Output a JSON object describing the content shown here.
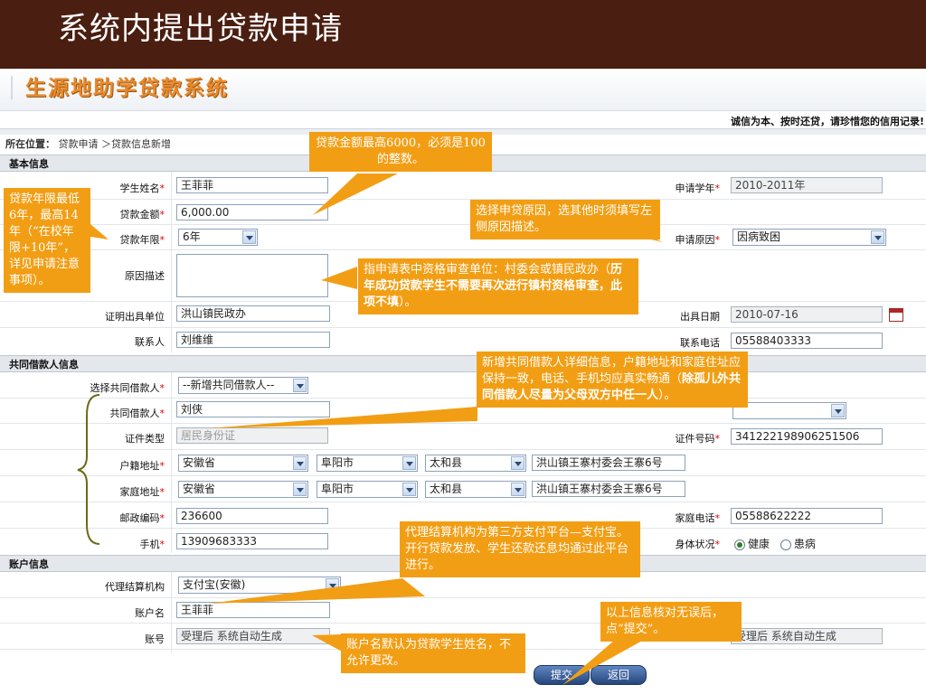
{
  "slide": {
    "title": "系统内提出贷款申请"
  },
  "app": {
    "logo": "生源地助学贷款系统",
    "slogan": "诚信为本、按时还贷，请珍惜您的信用记录!"
  },
  "breadcrumb": {
    "label": "所在位置：",
    "path": "贷款申请 ＞贷款信息新增"
  },
  "sections": {
    "basic": "基本信息",
    "coborrower": "共同借款人信息",
    "account": "账户信息"
  },
  "form": {
    "student_name": {
      "label": "学生姓名",
      "value": "王菲菲"
    },
    "loan_amount": {
      "label": "贷款金额",
      "value": "6,000.00"
    },
    "loan_term": {
      "label": "贷款年限",
      "value": "6年"
    },
    "reason_desc": {
      "label": "原因描述",
      "value": ""
    },
    "cert_unit": {
      "label": "证明出具单位",
      "value": "洪山镇民政办"
    },
    "contact": {
      "label": "联系人",
      "value": "刘维维"
    },
    "apply_year": {
      "label": "申请学年",
      "value": "2010-2011年"
    },
    "apply_reason": {
      "label": "申请原因",
      "value": "因病致困"
    },
    "issue_date": {
      "label": "出具日期",
      "value": "2010-07-16"
    },
    "contact_phone": {
      "label": "联系电话",
      "value": "05588403333"
    },
    "select_coborrower": {
      "label": "选择共同借款人",
      "value": "--新增共同借款人--"
    },
    "coborrower": {
      "label": "共同借款人",
      "value": "刘侠"
    },
    "id_type": {
      "label": "证件类型",
      "value": "居民身份证"
    },
    "id_number": {
      "label": "证件号码",
      "value": "341222198906251506"
    },
    "hukou_addr": {
      "label": "户籍地址",
      "province": "安徽省",
      "city": "阜阳市",
      "county": "太和县",
      "detail": "洪山镇王寨村委会王寨6号"
    },
    "home_addr": {
      "label": "家庭地址",
      "province": "安徽省",
      "city": "阜阳市",
      "county": "太和县",
      "detail": "洪山镇王寨村委会王寨6号"
    },
    "postcode": {
      "label": "邮政编码",
      "value": "236600"
    },
    "home_phone": {
      "label": "家庭电话",
      "value": "05588622222"
    },
    "mobile": {
      "label": "手机",
      "value": "13909683333"
    },
    "health": {
      "label": "身体状况",
      "opt1": "健康",
      "opt2": "患病"
    },
    "agent": {
      "label": "代理结算机构",
      "value": "支付宝(安徽)"
    },
    "account_name": {
      "label": "账户名",
      "value": "王菲菲"
    },
    "account_no": {
      "label": "账号",
      "value": "受理后 系统自动生成",
      "value2": "受理后 系统自动生成"
    }
  },
  "buttons": {
    "submit": "提交",
    "back": "返回"
  },
  "callouts": {
    "amount": "贷款金额最高6000，必须是100的整数。",
    "term": "贷款年限最低6年，最高14年（“在校年限+10年”，详见申请注意事项）。",
    "reason": "选择申贷原因，选其他时须填写左侧原因描述。",
    "unit_a": "指申请表中资格审查单位：村委会或镇民政办（",
    "unit_b": "历年成功贷款学生不需要再次进行镇村资格审查，此项不填",
    "unit_c": "）。",
    "cob_a": "新增共同借款人详细信息，户籍地址和家庭住址应保持一致，电话、手机均应真实畅通（",
    "cob_b": "除孤儿外共同借款人尽量为父母双方中任一人",
    "cob_c": "）。",
    "agent": "代理结算机构为第三方支付平台—支付宝。开行贷款发放、学生还款还息均通过此平台进行。",
    "account_name": "账户名默认为贷款学生姓名，不允许更改。",
    "submit": "以上信息核对无误后，点“提交”。"
  }
}
